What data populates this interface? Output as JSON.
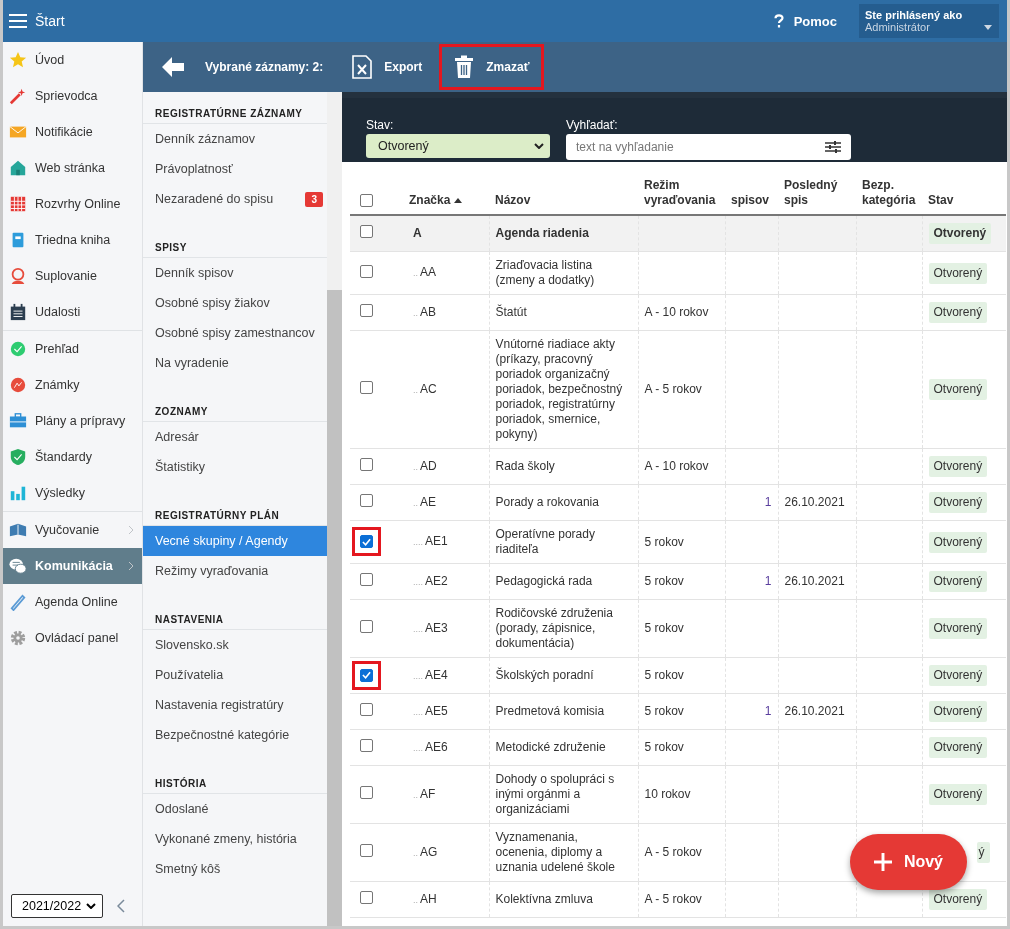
{
  "top_bar": {
    "title": "Štart",
    "help": "Pomoc",
    "user_label": "Ste prihlásený ako",
    "user_name": "Administrátor"
  },
  "sidebar": {
    "groups": [
      [
        {
          "label": "Úvod",
          "selected": false,
          "submenu": false
        },
        {
          "label": "Sprievodca",
          "selected": false,
          "submenu": false
        },
        {
          "label": "Notifikácie",
          "selected": false,
          "submenu": false
        },
        {
          "label": "Web stránka",
          "selected": false,
          "submenu": false
        },
        {
          "label": "Rozvrhy Online",
          "selected": false,
          "submenu": false
        },
        {
          "label": "Triedna kniha",
          "selected": false,
          "submenu": false
        },
        {
          "label": "Suplovanie",
          "selected": false,
          "submenu": false
        },
        {
          "label": "Udalosti",
          "selected": false,
          "submenu": false
        }
      ],
      [
        {
          "label": "Prehľad",
          "selected": false,
          "submenu": false
        },
        {
          "label": "Známky",
          "selected": false,
          "submenu": false
        },
        {
          "label": "Plány a prípravy",
          "selected": false,
          "submenu": false
        },
        {
          "label": "Štandardy",
          "selected": false,
          "submenu": false
        },
        {
          "label": "Výsledky",
          "selected": false,
          "submenu": false
        }
      ],
      [
        {
          "label": "Vyučovanie",
          "selected": false,
          "submenu": true
        },
        {
          "label": "Komunikácia",
          "selected": true,
          "submenu": true
        },
        {
          "label": "Agenda Online",
          "selected": false,
          "submenu": false
        },
        {
          "label": "Ovládací panel",
          "selected": false,
          "submenu": false
        }
      ]
    ],
    "year": "2021/2022"
  },
  "toolbar": {
    "selection": "Vybrané záznamy: 2:",
    "buttons": [
      {
        "label": "Export",
        "highlighted": false
      },
      {
        "label": "Zmazať",
        "highlighted": true
      }
    ]
  },
  "menu": {
    "sections": [
      {
        "title": "REGISTRATÚRNE ZÁZNAMY",
        "items": [
          {
            "label": "Denník záznamov",
            "selected": false
          },
          {
            "label": "Právoplatnosť",
            "selected": false
          },
          {
            "label": "Nezaradené do spisu",
            "selected": false,
            "badge": "3"
          }
        ]
      },
      {
        "title": "SPISY",
        "items": [
          {
            "label": "Denník spisov",
            "selected": false
          },
          {
            "label": "Osobné spisy žiakov",
            "selected": false
          },
          {
            "label": "Osobné spisy zamestnancov",
            "selected": false
          },
          {
            "label": "Na vyradenie",
            "selected": false
          }
        ]
      },
      {
        "title": "ZOZNAMY",
        "items": [
          {
            "label": "Adresár",
            "selected": false
          },
          {
            "label": "Štatistiky",
            "selected": false
          }
        ]
      },
      {
        "title": "REGISTRATÚRNY PLÁN",
        "items": [
          {
            "label": "Vecné skupiny / Agendy",
            "selected": true
          },
          {
            "label": "Režimy vyraďovania",
            "selected": false
          }
        ]
      },
      {
        "title": "NASTAVENIA",
        "items": [
          {
            "label": "Slovensko.sk",
            "selected": false
          },
          {
            "label": "Používatelia",
            "selected": false
          },
          {
            "label": "Nastavenia registratúry",
            "selected": false
          },
          {
            "label": "Bezpečnostné kategórie",
            "selected": false
          }
        ]
      },
      {
        "title": "HISTÓRIA",
        "items": [
          {
            "label": "Odoslané",
            "selected": false
          },
          {
            "label": "Vykonané zmeny, história",
            "selected": false
          },
          {
            "label": "Smetný kôš",
            "selected": false
          }
        ]
      }
    ]
  },
  "filters": {
    "status": {
      "label": "Stav:",
      "value": "Otvorený"
    },
    "search": {
      "label": "Vyhľadať:",
      "placeholder": "text na vyhľadanie"
    }
  },
  "table": {
    "header_checked": false,
    "columns": [
      {
        "label": "Značka",
        "sorted": true
      },
      {
        "label": "Názov",
        "sorted": false
      },
      {
        "label": "Režim vyraďovania",
        "sorted": false
      },
      {
        "label": "spisov",
        "sorted": false
      },
      {
        "label": "Posledný spis",
        "sorted": false
      },
      {
        "label": "Bezp. kategória",
        "sorted": false
      },
      {
        "label": "Stav",
        "sorted": false
      }
    ],
    "rows": [
      {
        "kind": "group",
        "checked": false,
        "highlighted": false,
        "marker": "",
        "code": "A",
        "name": "Agenda riadenia",
        "mode": "",
        "files": "",
        "last": "",
        "category": "",
        "status": "Otvorený"
      },
      {
        "kind": "item",
        "checked": false,
        "highlighted": false,
        "marker": "..",
        "code": "AA",
        "name": "Zriaďovacia listina (zmeny a dodatky)",
        "mode": "",
        "files": "",
        "last": "",
        "category": "",
        "status": "Otvorený"
      },
      {
        "kind": "item",
        "checked": false,
        "highlighted": false,
        "marker": "..",
        "code": "AB",
        "name": "Štatút",
        "mode": "A - 10 rokov",
        "files": "",
        "last": "",
        "category": "",
        "status": "Otvorený"
      },
      {
        "kind": "item",
        "checked": false,
        "highlighted": false,
        "marker": "..",
        "code": "AC",
        "name": "Vnútorné riadiace akty (príkazy, pracovný poriadok organizačný poriadok, bezpečnostný poriadok, registratúrny poriadok, smernice, pokyny)",
        "mode": "A - 5 rokov",
        "files": "",
        "last": "",
        "category": "",
        "status": "Otvorený"
      },
      {
        "kind": "item",
        "checked": false,
        "highlighted": false,
        "marker": "..",
        "code": "AD",
        "name": "Rada školy",
        "mode": "A - 10 rokov",
        "files": "",
        "last": "",
        "category": "",
        "status": "Otvorený"
      },
      {
        "kind": "item",
        "checked": false,
        "highlighted": false,
        "marker": "..",
        "code": "AE",
        "name": "Porady a rokovania",
        "mode": "",
        "files": "1",
        "last": "26.10.2021",
        "category": "",
        "status": "Otvorený"
      },
      {
        "kind": "item",
        "checked": true,
        "highlighted": true,
        "marker": "....",
        "code": "AE1",
        "name": "Operatívne porady riaditeľa",
        "mode": "5 rokov",
        "files": "",
        "last": "",
        "category": "",
        "status": "Otvorený"
      },
      {
        "kind": "item",
        "checked": false,
        "highlighted": false,
        "marker": "....",
        "code": "AE2",
        "name": "Pedagogická rada",
        "mode": "5 rokov",
        "files": "1",
        "last": "26.10.2021",
        "category": "",
        "status": "Otvorený"
      },
      {
        "kind": "item",
        "checked": false,
        "highlighted": false,
        "marker": "....",
        "code": "AE3",
        "name": "Rodičovské združenia (porady, zápisnice, dokumentácia)",
        "mode": "5 rokov",
        "files": "",
        "last": "",
        "category": "",
        "status": "Otvorený"
      },
      {
        "kind": "item",
        "checked": true,
        "highlighted": true,
        "marker": "....",
        "code": "AE4",
        "name": "Školských poradní",
        "mode": "5 rokov",
        "files": "",
        "last": "",
        "category": "",
        "status": "Otvorený"
      },
      {
        "kind": "item",
        "checked": false,
        "highlighted": false,
        "marker": "....",
        "code": "AE5",
        "name": "Predmetová komisia",
        "mode": "5 rokov",
        "files": "1",
        "last": "26.10.2021",
        "category": "",
        "status": "Otvorený"
      },
      {
        "kind": "item",
        "checked": false,
        "highlighted": false,
        "marker": "....",
        "code": "AE6",
        "name": "Metodické združenie",
        "mode": "5 rokov",
        "files": "",
        "last": "",
        "category": "",
        "status": "Otvorený"
      },
      {
        "kind": "item",
        "checked": false,
        "highlighted": false,
        "marker": "..",
        "code": "AF",
        "name": "Dohody o spolupráci s inými orgánmi a organizáciami",
        "mode": "10 rokov",
        "files": "",
        "last": "",
        "category": "",
        "status": "Otvorený"
      },
      {
        "kind": "item",
        "checked": false,
        "highlighted": false,
        "marker": "..",
        "code": "AG",
        "name": "Vyznamenania, ocenenia, diplomy a uznania udelené škole",
        "mode": "A - 5 rokov",
        "files": "",
        "last": "",
        "category": "",
        "status": "ý"
      },
      {
        "kind": "item",
        "checked": false,
        "highlighted": false,
        "marker": "..",
        "code": "AH",
        "name": "Kolektívna zmluva",
        "mode": "A - 5 rokov",
        "files": "",
        "last": "",
        "category": "",
        "status": "Otvorený"
      }
    ]
  },
  "fab": {
    "label": "Nový"
  }
}
